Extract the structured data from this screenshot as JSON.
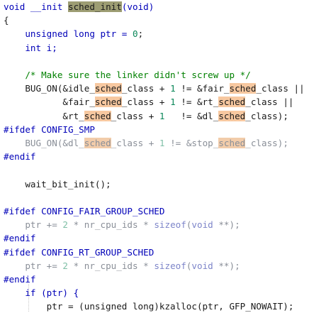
{
  "editor": {
    "search_term": "sched_init",
    "lines": [
      [
        [
          "void __init ",
          "kw"
        ],
        [
          "sched_init",
          "sel"
        ],
        [
          "(void)",
          "kw"
        ]
      ],
      [
        [
          "{",
          "id"
        ]
      ],
      [
        [
          "    unsigned long ptr = ",
          "kw"
        ],
        [
          "0",
          "num"
        ],
        [
          ";",
          "id"
        ]
      ],
      [
        [
          "    int i;",
          "kw"
        ]
      ],
      [
        [
          "",
          ""
        ]
      ],
      [
        [
          "    /* Make sure the linker didn't screw up */",
          "cm"
        ]
      ],
      [
        [
          "    BUG_ON(&idle_",
          "id"
        ],
        [
          "sched",
          "match"
        ],
        [
          "_class + ",
          "id"
        ],
        [
          "1",
          "num"
        ],
        [
          " != &fair_",
          "id"
        ],
        [
          "sched",
          "match"
        ],
        [
          "_class ||",
          "id"
        ]
      ],
      [
        [
          "           &fair_",
          "id"
        ],
        [
          "sched",
          "match"
        ],
        [
          "_class + ",
          "id"
        ],
        [
          "1",
          "num"
        ],
        [
          " != &rt_",
          "id"
        ],
        [
          "sched",
          "match"
        ],
        [
          "_class ||",
          "id"
        ]
      ],
      [
        [
          "           &rt_",
          "id"
        ],
        [
          "sched",
          "match"
        ],
        [
          "_class + ",
          "id"
        ],
        [
          "1",
          "num"
        ],
        [
          "   != &dl_",
          "id"
        ],
        [
          "sched",
          "match"
        ],
        [
          "_class);",
          "id"
        ]
      ],
      [
        [
          "#ifdef CONFIG_SMP",
          "pp"
        ]
      ],
      [
        [
          "    BUG_ON(&dl_",
          "dim"
        ],
        [
          "sched",
          "matchdim"
        ],
        [
          "_class + ",
          "dim"
        ],
        [
          "1",
          "dimnum"
        ],
        [
          " != &stop_",
          "dim"
        ],
        [
          "sched",
          "matchdim"
        ],
        [
          "_class);",
          "dim"
        ]
      ],
      [
        [
          "#endif",
          "pp"
        ]
      ],
      [
        [
          "",
          ""
        ]
      ],
      [
        [
          "    wait_bit_init();",
          "id"
        ]
      ],
      [
        [
          "",
          ""
        ]
      ],
      [
        [
          "#ifdef CONFIG_FAIR_GROUP_SCHED",
          "pp"
        ]
      ],
      [
        [
          "    ptr += ",
          "dim"
        ],
        [
          "2",
          "dimnum"
        ],
        [
          " * nr_cpu_ids * ",
          "dim"
        ],
        [
          "sizeof",
          "dimkw"
        ],
        [
          "(",
          "dim"
        ],
        [
          "void",
          "dimkw"
        ],
        [
          " **);",
          "dim"
        ]
      ],
      [
        [
          "#endif",
          "pp"
        ]
      ],
      [
        [
          "#ifdef CONFIG_RT_GROUP_SCHED",
          "pp"
        ]
      ],
      [
        [
          "    ptr += ",
          "dim"
        ],
        [
          "2",
          "dimnum"
        ],
        [
          " * nr_cpu_ids * ",
          "dim"
        ],
        [
          "sizeof",
          "dimkw"
        ],
        [
          "(",
          "dim"
        ],
        [
          "void",
          "dimkw"
        ],
        [
          " **);",
          "dim"
        ]
      ],
      [
        [
          "#endif",
          "pp"
        ]
      ],
      [
        [
          "    if (ptr) {",
          "kw"
        ]
      ],
      [
        [
          "        ptr = (unsigned long)kzalloc(ptr, GFP_NOWAIT);",
          "id"
        ]
      ]
    ]
  }
}
